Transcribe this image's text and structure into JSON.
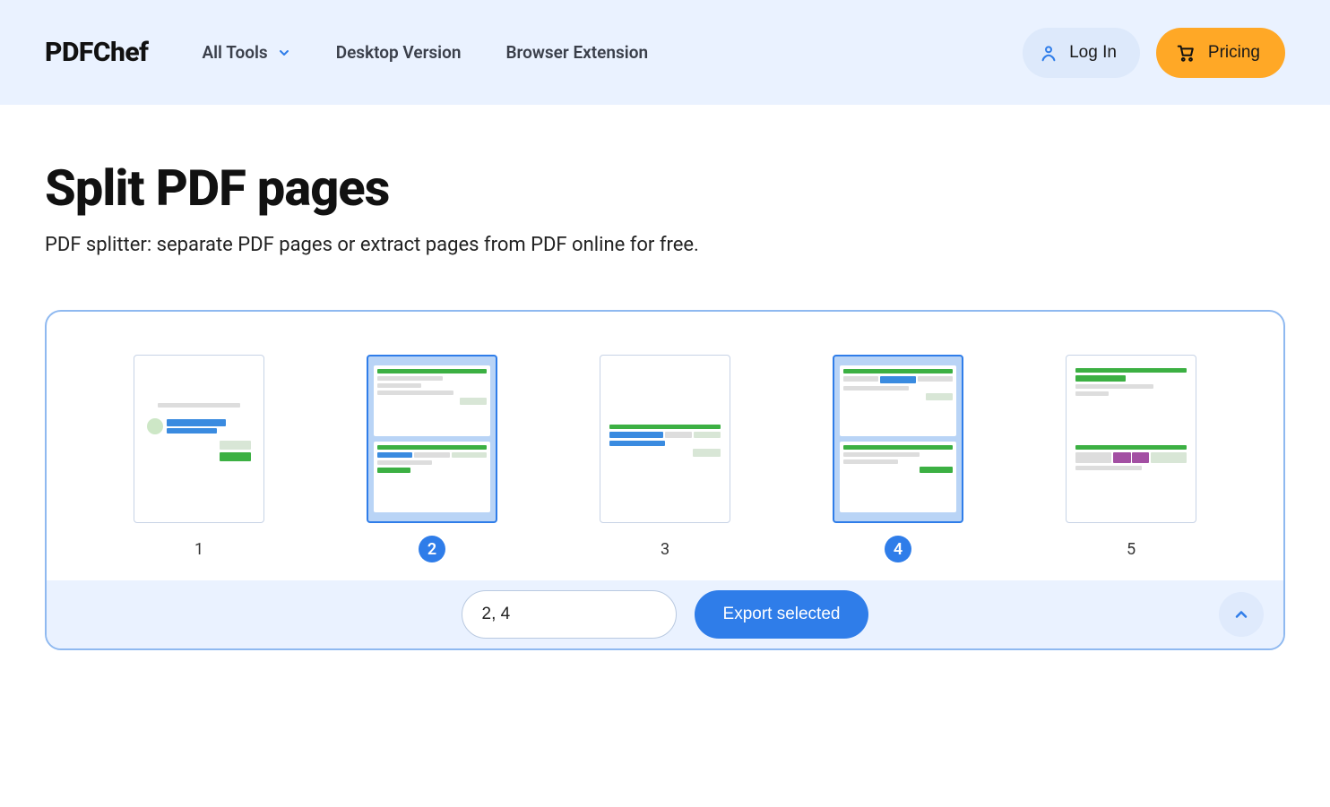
{
  "header": {
    "logo": "PDFChef",
    "nav": {
      "all_tools": "All Tools",
      "desktop": "Desktop Version",
      "extension": "Browser Extension"
    },
    "login": "Log In",
    "pricing": "Pricing"
  },
  "page": {
    "title": "Split PDF pages",
    "subtitle": "PDF splitter: separate PDF pages or extract pages from PDF online for free."
  },
  "pages": [
    {
      "num": "1",
      "selected": false
    },
    {
      "num": "2",
      "selected": true
    },
    {
      "num": "3",
      "selected": false
    },
    {
      "num": "4",
      "selected": true
    },
    {
      "num": "5",
      "selected": false
    }
  ],
  "controls": {
    "pages_input_value": "2, 4",
    "export_label": "Export selected"
  }
}
